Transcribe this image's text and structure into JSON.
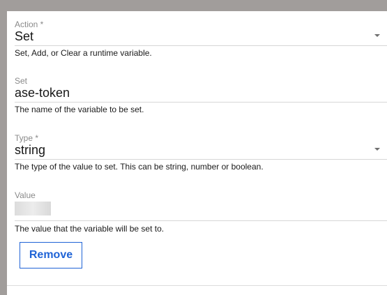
{
  "form": {
    "action": {
      "label": "Action *",
      "value": "Set",
      "helper": "Set, Add, or Clear a runtime variable."
    },
    "set": {
      "label": "Set",
      "value": "ase-token",
      "helper": "The name of the variable to be set."
    },
    "type": {
      "label": "Type *",
      "value": "string",
      "helper": "The type of the value to set. This can be string, number or boolean."
    },
    "value": {
      "label": "Value",
      "helper": "The value that the variable will be set to."
    },
    "remove_label": "Remove"
  },
  "icons": {
    "dropdown": "chevron-down-icon"
  },
  "colors": {
    "accent": "#1f63d6",
    "background": "#a19d9b",
    "panel": "#ffffff"
  }
}
